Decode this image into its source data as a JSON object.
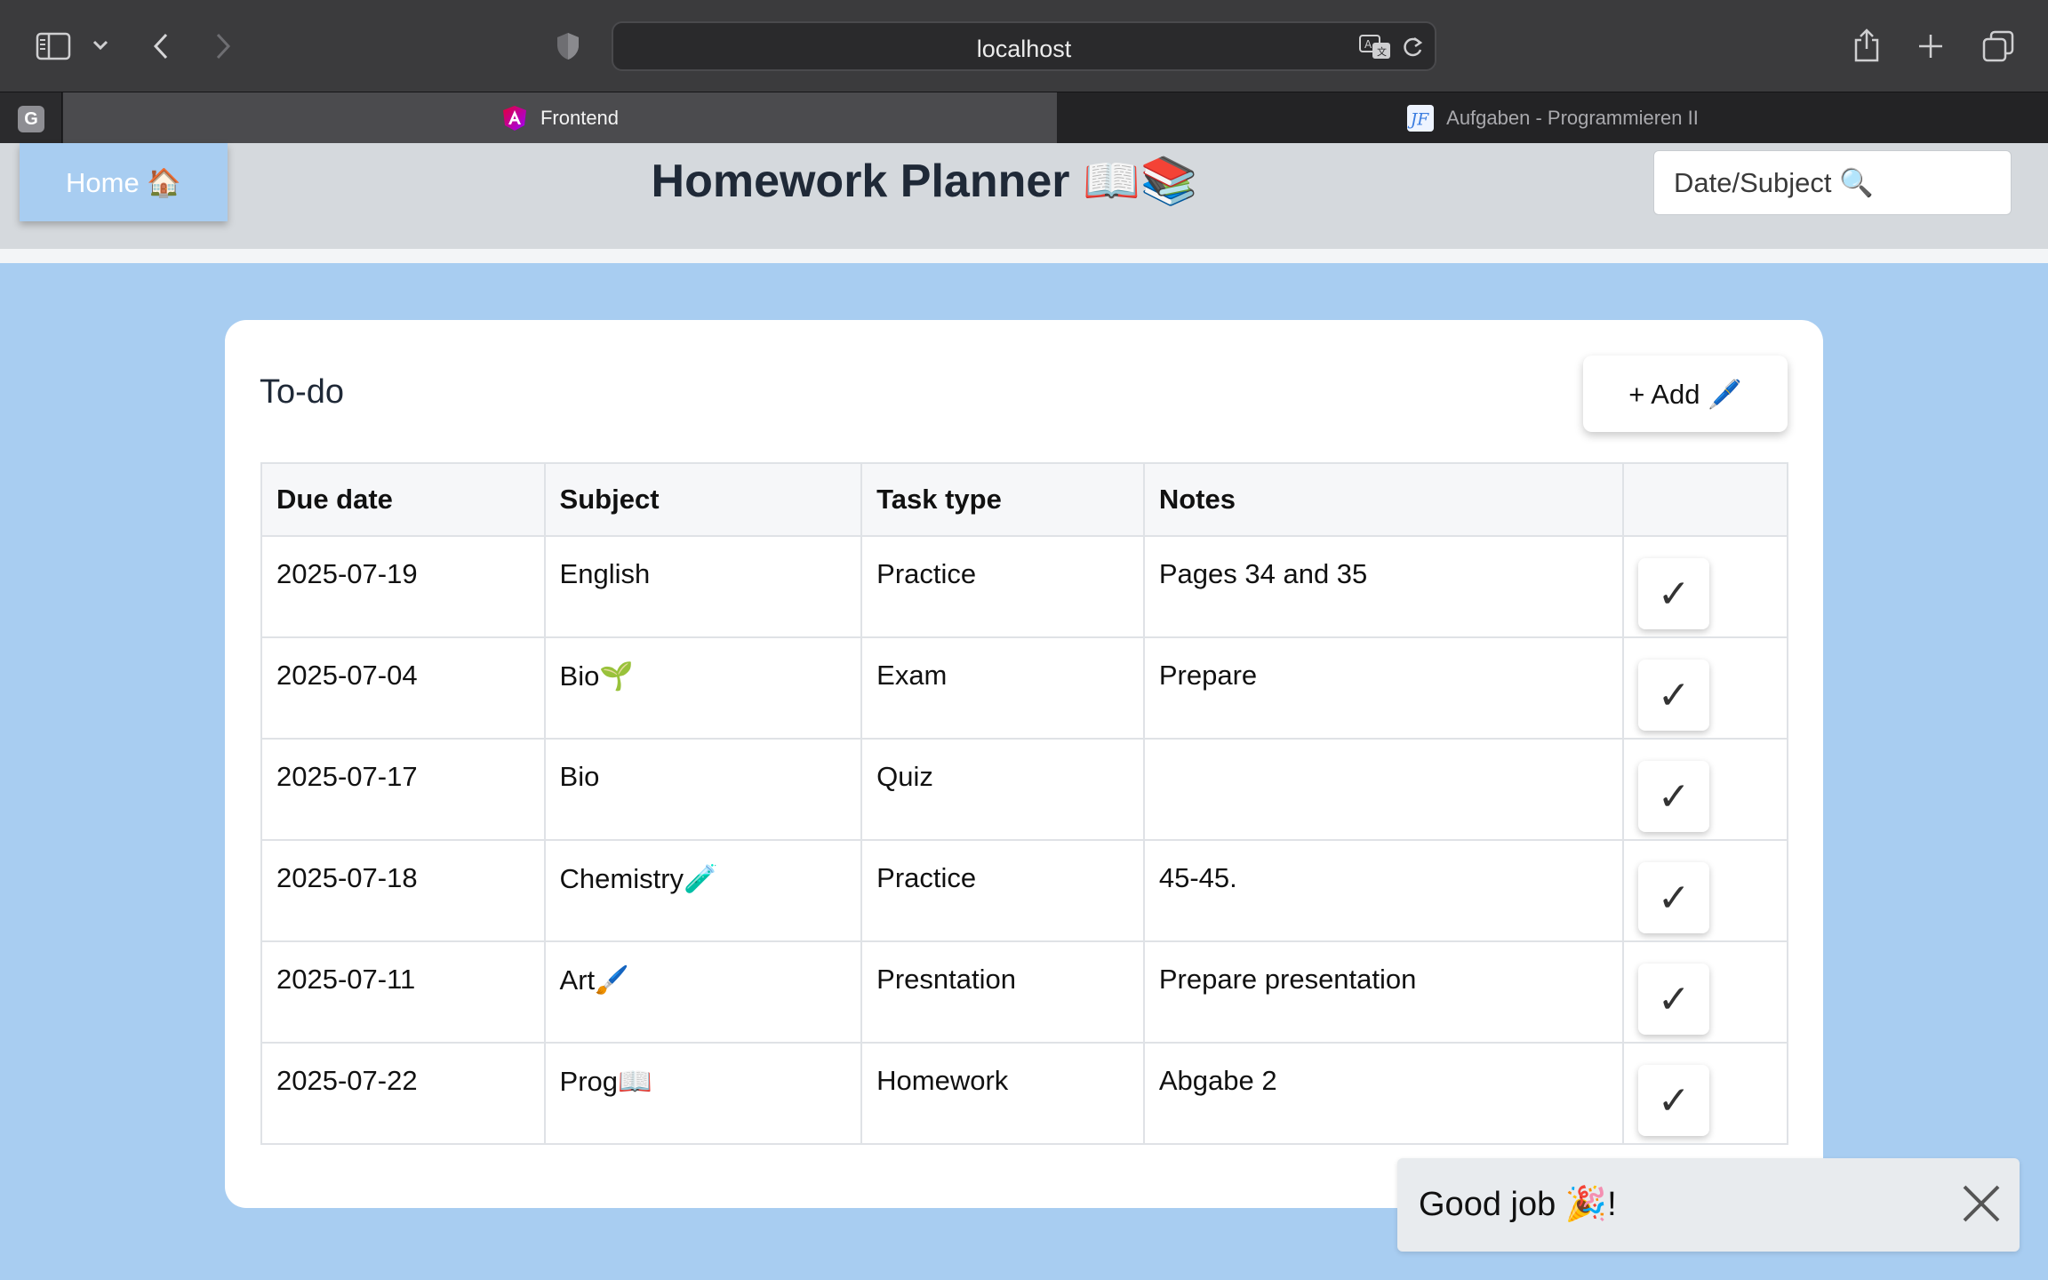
{
  "browser": {
    "url": "localhost",
    "pinned_tab_letter": "G",
    "tabs": [
      {
        "label": "Frontend"
      },
      {
        "label": "Aufgaben - Programmieren II"
      }
    ]
  },
  "header": {
    "home_label": "Home 🏠",
    "title": "Homework Planner 📖📚",
    "search_placeholder": "Date/Subject 🔍"
  },
  "main": {
    "section_title": "To-do",
    "add_label": "+ Add 🖊️",
    "columns": [
      "Due date",
      "Subject",
      "Task type",
      "Notes",
      ""
    ],
    "rows": [
      {
        "date": "2025-07-19",
        "subject": "English",
        "type": "Practice",
        "notes": "Pages 34 and 35"
      },
      {
        "date": "2025-07-04",
        "subject": "Bio🌱",
        "type": "Exam",
        "notes": "Prepare"
      },
      {
        "date": "2025-07-17",
        "subject": "Bio",
        "type": "Quiz",
        "notes": ""
      },
      {
        "date": "2025-07-18",
        "subject": "Chemistry🧪",
        "type": "Practice",
        "notes": "45-45."
      },
      {
        "date": "2025-07-11",
        "subject": "Art🖌️",
        "type": "Presntation",
        "notes": "Prepare presentation"
      },
      {
        "date": "2025-07-22",
        "subject": "Prog📖",
        "type": "Homework",
        "notes": "Abgabe 2"
      }
    ],
    "done_symbol": "✓"
  },
  "toast": {
    "message": "Good job 🎉!"
  },
  "colors": {
    "page_bg": "#a8cdf1",
    "header_bg": "#d5d9dd",
    "home_button": "#a8cdf1",
    "chrome": "#3b3b3d"
  }
}
